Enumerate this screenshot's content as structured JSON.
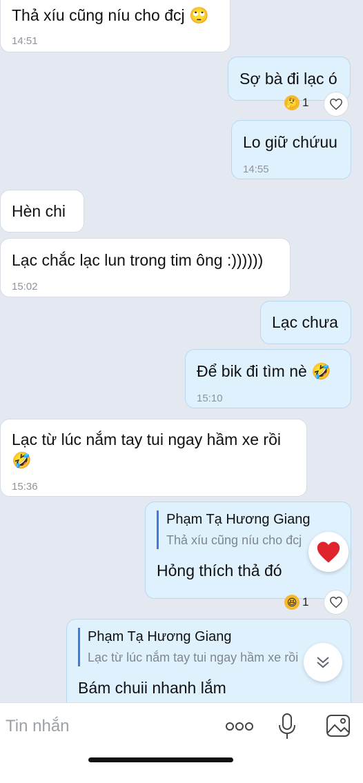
{
  "messages": [
    {
      "text": "Thả xíu cũng níu cho đcj 🙄",
      "time": "14:51"
    },
    {
      "text": "Sợ bà đi lạc ó",
      "reaction": {
        "emoji": "🤔",
        "count": "1"
      }
    },
    {
      "text": "Lo giữ chứuu",
      "time": "14:55"
    },
    {
      "text": "Hèn chi"
    },
    {
      "text": "Lạc chắc lạc lun trong tim ông :))))))",
      "time": "15:02"
    },
    {
      "text": "Lạc chưa"
    },
    {
      "text": "Để bik đi tìm nè 🤣",
      "time": "15:10"
    },
    {
      "text": "Lạc từ lúc nắm tay tui ngay hầm xe rồi",
      "text2": "🤣",
      "time": "15:36"
    },
    {
      "quote_name": "Phạm Tạ Hương Giang",
      "quote_text": "Thả xíu cũng níu cho đcj",
      "text": "Hỏng thích thả đó",
      "reaction": {
        "emoji": "😆",
        "count": "1"
      }
    },
    {
      "quote_name": "Phạm Tạ Hương Giang",
      "quote_text": "Lạc từ lúc nắm tay tui ngay hầm xe rồi",
      "text": "Bám chuii nhanh lắm"
    }
  ],
  "reaction_popup": {
    "emoji": "❤️"
  },
  "input": {
    "placeholder": "Tin nhắn"
  },
  "icons": [
    "heart-icon",
    "chevron-down-icon",
    "more-icon",
    "microphone-icon",
    "image-icon"
  ],
  "colors": {
    "incoming": "#ffffff",
    "outgoing": "#dff1fd",
    "background": "#e4e9f1",
    "quote_bar": "#3d7bd6"
  }
}
